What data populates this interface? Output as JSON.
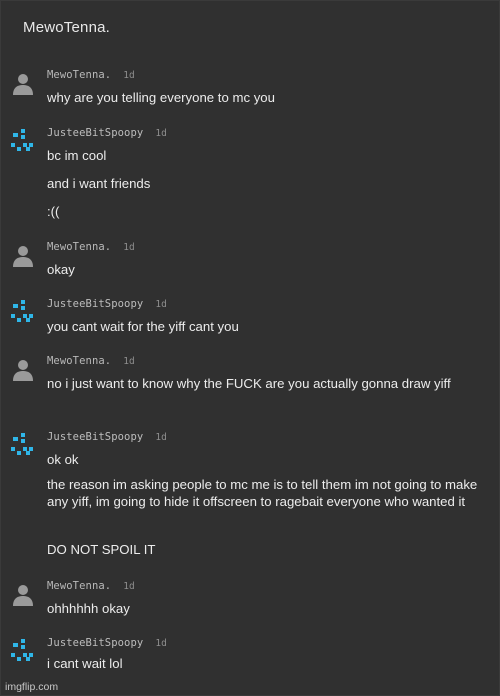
{
  "thread": {
    "title": "MewoTenna."
  },
  "users": {
    "user1": "MewoTenna.",
    "user2": "JusteeBitSpoopy"
  },
  "messages": [
    {
      "author": "MewoTenna.",
      "time": "1d",
      "lines": [
        "why are you telling everyone to mc you"
      ]
    },
    {
      "author": "JusteeBitSpoopy",
      "time": "1d",
      "lines": [
        "bc im cool",
        "and i want friends",
        ":(("
      ]
    },
    {
      "author": "MewoTenna.",
      "time": "1d",
      "lines": [
        "okay"
      ]
    },
    {
      "author": "JusteeBitSpoopy",
      "time": "1d",
      "lines": [
        "you cant wait for the yiff cant you"
      ]
    },
    {
      "author": "MewoTenna.",
      "time": "1d",
      "lines": [
        "no i just want to know why the FUCK are you actually gonna draw yiff"
      ]
    },
    {
      "author": "JusteeBitSpoopy",
      "time": "1d",
      "lines": [
        "ok ok",
        "the reason im asking people to mc me is to tell them im not going to make any yiff, im going to hide it offscreen to ragebait everyone who wanted it",
        "DO NOT SPOIL IT"
      ]
    },
    {
      "author": "MewoTenna.",
      "time": "1d",
      "lines": [
        "ohhhhhh okay"
      ]
    },
    {
      "author": "JusteeBitSpoopy",
      "time": "1d",
      "lines": [
        "i cant wait lol"
      ]
    }
  ],
  "watermark": "imgflip.com",
  "icons": {
    "user1_avatar": "default-user-icon",
    "user2_avatar": "pixel-face-icon"
  },
  "colors": {
    "background": "#303030",
    "text": "#ececec",
    "author": "#b9b9b9",
    "timestamp": "#8e8e8e",
    "user2_avatar": "#2fb6e8",
    "user1_avatar": "#9a9a9a"
  }
}
